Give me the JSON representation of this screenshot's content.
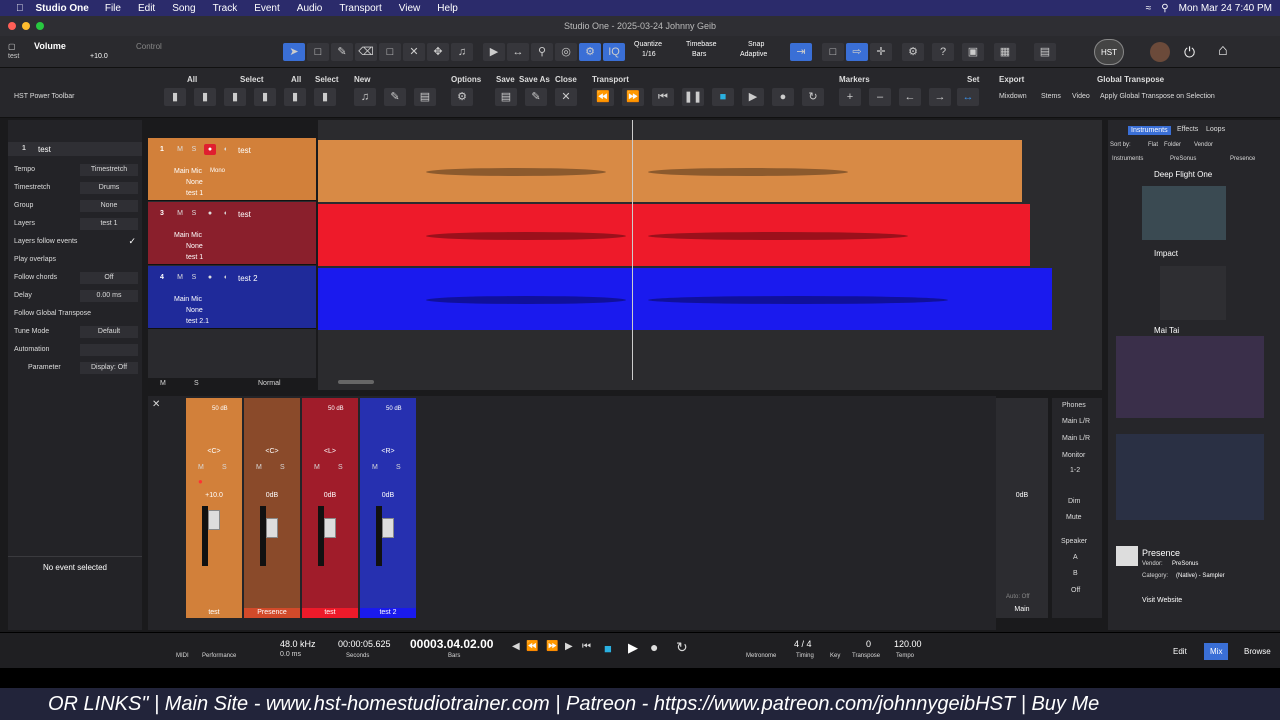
{
  "menubar": {
    "app": "Studio One",
    "items": [
      "File",
      "Edit",
      "Song",
      "Track",
      "Event",
      "Audio",
      "Transport",
      "View",
      "Help"
    ],
    "datetime": "Mon Mar 24  7:40 PM"
  },
  "window": {
    "title": "Studio One - 2025-03-24 Johnny Geib"
  },
  "toolbar1": {
    "param_name": "Volume",
    "param_track": "test",
    "param_value": "+10.0",
    "control_label": "Control",
    "quantize_label": "Quantize",
    "quantize_value": "1/16",
    "timebase_label": "Timebase",
    "timebase_value": "Bars",
    "snap_label": "Snap",
    "snap_value": "Adaptive"
  },
  "toolbar2": {
    "preset": "HST Power Toolbar",
    "groups": {
      "all1": "All",
      "select1": "Select",
      "all2": "All",
      "select2": "Select",
      "new": "New",
      "options": "Options",
      "save": "Save",
      "save_as": "Save As",
      "close": "Close",
      "transport": "Transport",
      "markers": "Markers",
      "set": "Set",
      "export": "Export",
      "global_transpose": "Global Transpose"
    },
    "export_items": [
      "Mixdown",
      "Stems",
      "Video",
      "Apply Global Transpose on Selection"
    ]
  },
  "inspector": {
    "track_num": "1",
    "track_name": "test",
    "rows": [
      {
        "k": "Tempo",
        "v": "Timestretch"
      },
      {
        "k": "Timestretch",
        "v": "Drums"
      },
      {
        "k": "Group",
        "v": "None"
      },
      {
        "k": "Layers",
        "v": "test 1"
      },
      {
        "k": "Layers follow events",
        "v": ""
      },
      {
        "k": "Play overlaps",
        "v": ""
      },
      {
        "k": "Follow chords",
        "v": "Off"
      },
      {
        "k": "Delay",
        "v": "0.00 ms"
      },
      {
        "k": "Follow Global Transpose",
        "v": ""
      },
      {
        "k": "Tune Mode",
        "v": "Default"
      },
      {
        "k": "Automation",
        "v": ""
      },
      {
        "k": "Parameter",
        "v": "Display: Off"
      }
    ],
    "no_event": "No event selected"
  },
  "tracks": [
    {
      "num": "1",
      "name": "test",
      "input": "Main Mic",
      "mode": "Mono",
      "out": "None",
      "layer": "test 1",
      "color": "#d2803a",
      "clip": "#d88a45"
    },
    {
      "num": "3",
      "name": "test",
      "input": "Main Mic",
      "mode": "",
      "out": "None",
      "layer": "test 1",
      "color": "#8a1f2c",
      "clip": "#ee1a2a"
    },
    {
      "num": "4",
      "name": "test 2",
      "input": "Main Mic",
      "mode": "",
      "out": "None",
      "layer": "test 2.1",
      "color": "#1f2a9a",
      "clip": "#1a1aee"
    }
  ],
  "tracklist_footer": {
    "m": "M",
    "s": "S",
    "mode": "Normal"
  },
  "ruler": [
    "1",
    "2",
    "3",
    "4",
    "5",
    "6",
    "7"
  ],
  "mixer": {
    "strips": [
      {
        "name": "test",
        "db": "+10.0",
        "pan": "<C>",
        "color": "#d2803a",
        "gain": "50 dB"
      },
      {
        "name": "Presence",
        "db": "0dB",
        "pan": "<C>",
        "color": "#8a4a2a",
        "gain": ""
      },
      {
        "name": "test",
        "db": "0dB",
        "pan": "<L>",
        "color": "#a01c2a",
        "gain": "50 dB"
      },
      {
        "name": "test 2",
        "db": "0dB",
        "pan": "<R>",
        "color": "#2630b0",
        "gain": "50 dB"
      }
    ],
    "main_db": "0dB",
    "main_name": "Main",
    "auto": "Auto: Off",
    "outputs": [
      "Phones",
      "Main L/R",
      "Main L/R",
      "Monitor",
      "1-2"
    ],
    "dim": "Dim",
    "mute": "Mute",
    "speaker": "Speaker",
    "speaker_items": [
      "A",
      "B",
      "Off"
    ]
  },
  "browser": {
    "tabs": [
      "Instruments",
      "Effects",
      "Loops"
    ],
    "sort_label": "Sort by:",
    "sort_items": [
      "Flat",
      "Folder",
      "Vendor"
    ],
    "path": [
      "Instruments",
      "PreSonus",
      "Presence"
    ],
    "items": [
      "Deep Flight One",
      "Impact",
      "Mai Tai"
    ],
    "selected_name": "Presence",
    "vendor_label": "Vendor:",
    "vendor": "PreSonus",
    "category_label": "Category:",
    "category": "(Native) - Sampler",
    "visit": "Visit Website"
  },
  "transport": {
    "sample_rate": "48.0 kHz",
    "latency": "0.0 ms",
    "seconds": "00:00:05.625",
    "seconds_label": "Seconds",
    "bars": "00003.04.02.00",
    "bars_label": "Bars",
    "midi": "MIDI",
    "performance": "Performance",
    "metronome": "Metronome",
    "timing": "Timing",
    "sig": "4 / 4",
    "key_label": "Key",
    "transpose_value": "0",
    "transpose_label": "Transpose",
    "tempo": "120.00",
    "tempo_label": "Tempo",
    "tabs": [
      "Edit",
      "Mix",
      "Browse"
    ]
  },
  "ticker": "OR LINKS\" | Main Site - www.hst-homestudiotrainer.com | Patreon - https://www.patreon.com/johnnygeibHST | Buy Me"
}
